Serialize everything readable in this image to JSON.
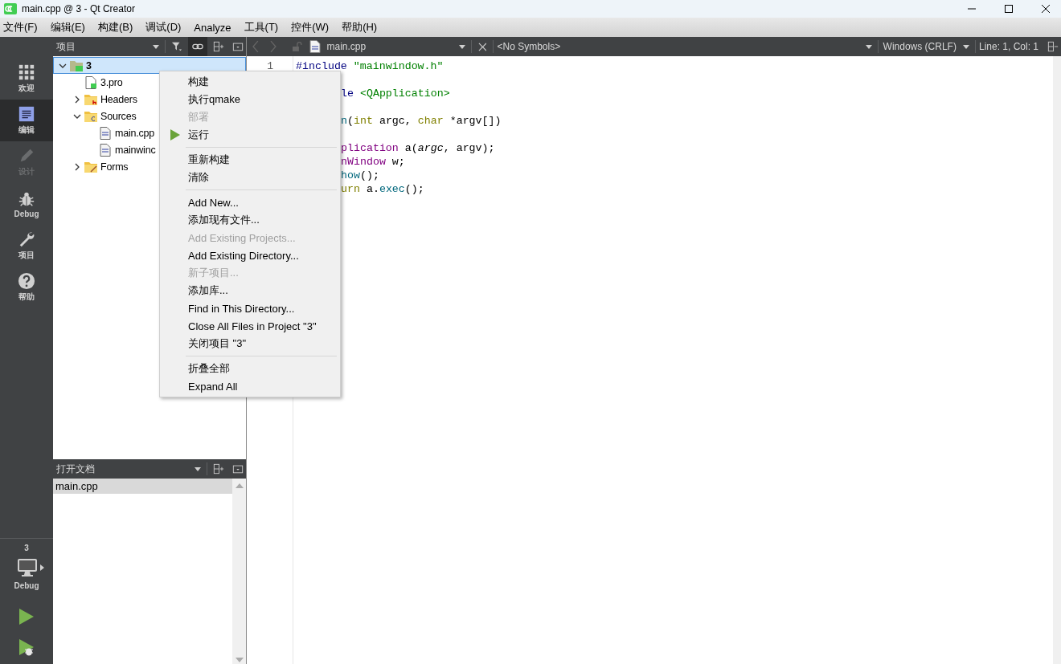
{
  "window": {
    "title": "main.cpp @ 3 - Qt Creator"
  },
  "menubar": [
    "文件(F)",
    "编辑(E)",
    "构建(B)",
    "调试(D)",
    "Analyze",
    "工具(T)",
    "控件(W)",
    "帮助(H)"
  ],
  "modes": [
    {
      "label": "欢迎",
      "kind": "welcome",
      "selected": false,
      "disabled": false
    },
    {
      "label": "编辑",
      "kind": "edit",
      "selected": true,
      "disabled": false
    },
    {
      "label": "设计",
      "kind": "design",
      "selected": false,
      "disabled": true
    },
    {
      "label": "Debug",
      "kind": "debug",
      "selected": false,
      "disabled": false
    },
    {
      "label": "项目",
      "kind": "projects",
      "selected": false,
      "disabled": false
    },
    {
      "label": "帮助",
      "kind": "help",
      "selected": false,
      "disabled": false
    }
  ],
  "target": {
    "project": "3",
    "config": "Debug"
  },
  "projects_panel": {
    "title": "项目",
    "tree": [
      {
        "label": "3",
        "kind": "project",
        "expanded": true,
        "selected": true,
        "children": [
          {
            "label": "3.pro",
            "kind": "pro",
            "selected": false
          },
          {
            "label": "Headers",
            "kind": "folder-h",
            "expanded": false,
            "selected": false
          },
          {
            "label": "Sources",
            "kind": "folder-cpp",
            "expanded": true,
            "selected": false,
            "children": [
              {
                "label": "main.cpp",
                "kind": "cpp",
                "selected": false
              },
              {
                "label": "mainwinc",
                "kind": "cpp",
                "selected": false
              }
            ]
          },
          {
            "label": "Forms",
            "kind": "folder-forms",
            "expanded": false,
            "selected": false
          }
        ]
      }
    ]
  },
  "open_documents": {
    "title": "打开文档",
    "items": [
      {
        "label": "main.cpp",
        "selected": true
      }
    ]
  },
  "editor": {
    "file": "main.cpp",
    "symbols": "<No Symbols>",
    "line_ending": "Windows (CRLF)",
    "position": "Line: 1, Col: 1",
    "line_numbers": [
      "1"
    ],
    "lines": [
      {
        "kind": "code",
        "covered": false,
        "tokens": [
          {
            "text": "#include ",
            "kind": "preproc"
          },
          {
            "text": "\"mainwindow.h\"",
            "kind": "string"
          }
        ]
      },
      {
        "kind": "blank"
      },
      {
        "kind": "code",
        "covered": true,
        "tokens": [
          {
            "text": "le ",
            "kind": "preproc"
          },
          {
            "text": "<QApplication>",
            "kind": "string"
          }
        ]
      },
      {
        "kind": "blank"
      },
      {
        "kind": "code",
        "covered": true,
        "tokens": [
          {
            "text": "n",
            "kind": "func"
          },
          {
            "text": "(",
            "kind": "plain"
          },
          {
            "text": "int",
            "kind": "keyword"
          },
          {
            "text": " argc, ",
            "kind": "plain"
          },
          {
            "text": "char",
            "kind": "keyword"
          },
          {
            "text": " *argv[])",
            "kind": "plain"
          }
        ]
      },
      {
        "kind": "blank"
      },
      {
        "kind": "code",
        "covered": true,
        "tokens": [
          {
            "text": "plication",
            "kind": "type"
          },
          {
            "text": " a(",
            "kind": "plain"
          },
          {
            "text": "argc",
            "kind": "param"
          },
          {
            "text": ", argv);",
            "kind": "plain"
          }
        ]
      },
      {
        "kind": "code",
        "covered": true,
        "tokens": [
          {
            "text": "nWindow",
            "kind": "type"
          },
          {
            "text": " w;",
            "kind": "plain"
          }
        ]
      },
      {
        "kind": "code",
        "covered": true,
        "tokens": [
          {
            "text": "how",
            "kind": "func"
          },
          {
            "text": "();",
            "kind": "plain"
          }
        ]
      },
      {
        "kind": "code",
        "covered": true,
        "tokens": [
          {
            "text": "urn",
            "kind": "keyword"
          },
          {
            "text": " a.",
            "kind": "plain"
          },
          {
            "text": "exec",
            "kind": "func"
          },
          {
            "text": "();",
            "kind": "plain"
          }
        ]
      }
    ]
  },
  "context_menu": {
    "groups": [
      [
        {
          "label": "构建",
          "kind": "plain",
          "disabled": false
        },
        {
          "label": "执行qmake",
          "kind": "plain",
          "disabled": false
        },
        {
          "label": "部署",
          "kind": "plain",
          "disabled": true
        },
        {
          "label": "运行",
          "kind": "run",
          "disabled": false
        }
      ],
      [
        {
          "label": "重新构建",
          "kind": "plain",
          "disabled": false
        },
        {
          "label": "清除",
          "kind": "plain",
          "disabled": false
        }
      ],
      [
        {
          "label": "Add New...",
          "kind": "plain",
          "disabled": false
        },
        {
          "label": "添加现有文件...",
          "kind": "plain",
          "disabled": false
        },
        {
          "label": "Add Existing Projects...",
          "kind": "plain",
          "disabled": true
        },
        {
          "label": "Add Existing Directory...",
          "kind": "plain",
          "disabled": false
        },
        {
          "label": "新子项目...",
          "kind": "plain",
          "disabled": true
        },
        {
          "label": "添加库...",
          "kind": "plain",
          "disabled": false
        },
        {
          "label": "Find in This Directory...",
          "kind": "plain",
          "disabled": false
        },
        {
          "label": "Close All Files in Project \"3\"",
          "kind": "plain",
          "disabled": false
        },
        {
          "label": "关闭项目 \"3\"",
          "kind": "plain",
          "disabled": false
        }
      ],
      [
        {
          "label": "折叠全部",
          "kind": "plain",
          "disabled": false
        },
        {
          "label": "Expand All",
          "kind": "plain",
          "disabled": false
        }
      ]
    ]
  }
}
